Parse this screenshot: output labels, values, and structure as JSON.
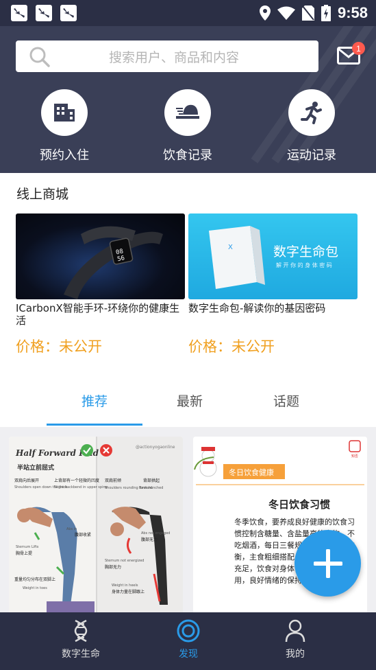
{
  "status_bar": {
    "time": "9:58"
  },
  "header": {
    "search_placeholder": "搜索用户、商品和内容",
    "mail_badge": "1",
    "quick_actions": [
      {
        "label": "预约入住",
        "icon": "building-icon"
      },
      {
        "label": "饮食记录",
        "icon": "food-dish-icon"
      },
      {
        "label": "运动记录",
        "icon": "running-icon"
      }
    ]
  },
  "mall": {
    "title": "线上商城",
    "products": [
      {
        "title": "ICarbonX智能手环-环绕你的健康生活",
        "price": "价格：未公开",
        "image_text": "08 56"
      },
      {
        "title": "数字生命包-解读你的基因密码",
        "price": "价格：未公开",
        "image_text": "数字生命包",
        "image_subtext": "解 开 你 的 身 体 密 码"
      }
    ]
  },
  "tabs": [
    {
      "label": "推荐",
      "active": true
    },
    {
      "label": "最新",
      "active": false
    },
    {
      "label": "话题",
      "active": false
    }
  ],
  "feed": {
    "cards": [
      {
        "heading": "Half Forward Fold",
        "subheading": "半站立前屈式",
        "texts": [
          "双肩向后展开",
          "Shoulders open down the back",
          "上背部有一个轻微的凹度",
          "Slight backbend in upper spine",
          "Sternum Lifts",
          "胸骨上提",
          "Abs in",
          "腹部收紧",
          "重量均匀分布在双脚上",
          "Weight in toes",
          "Shoulders rounding forward",
          "双肩前倾",
          "Back hunched",
          "背部拱起",
          "Sternum not energized",
          "胸部无力",
          "Weight in heels",
          "身体力量在脚跟上",
          "Abs not engaged",
          "腹部无力",
          "@actionyogaonline"
        ]
      },
      {
        "tag": "冬日饮食健康",
        "heading": "冬日饮食习惯",
        "body": "冬季饮食，要养成良好健康的饮食习惯控制含糖量、含盐量高的食物，不吃烟酒，每日三餐规律，确保营养均衡，主食粗细搭配，蔬菜和水果摄入充足，饮食对身体健康起到积极作用，良好情绪的保持。"
      }
    ]
  },
  "bottom_nav": [
    {
      "label": "数字生命",
      "icon": "dna-icon",
      "active": false
    },
    {
      "label": "发现",
      "icon": "discover-icon",
      "active": true
    },
    {
      "label": "我的",
      "icon": "user-icon",
      "active": false
    }
  ],
  "colors": {
    "accent": "#2a9be8",
    "header_bg": "#3a3f57",
    "price": "#f0a020",
    "badge": "#ff5a4e"
  }
}
